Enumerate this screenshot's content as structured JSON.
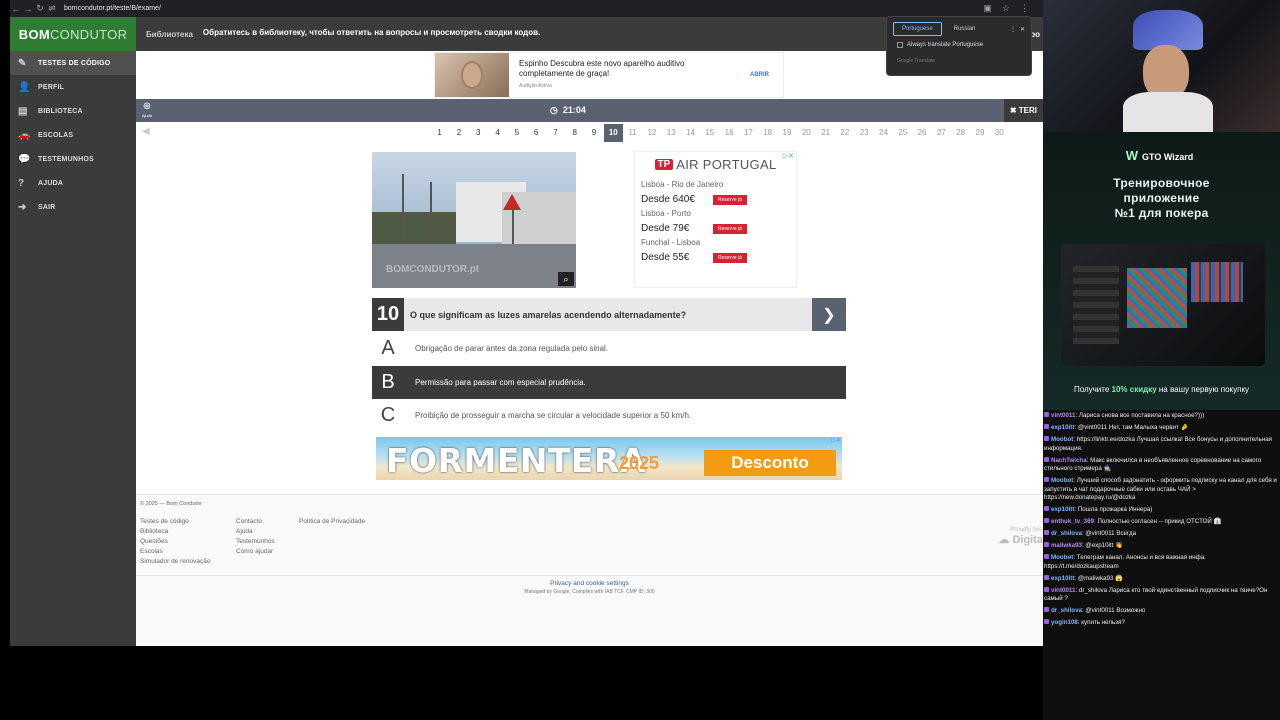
{
  "browser": {
    "url": "bomcondutor.pt/teste/B/exame/",
    "nav_icons": [
      "back-icon",
      "forward-icon",
      "reload-icon",
      "site-info-icon"
    ]
  },
  "logo": {
    "part1": "B",
    "part2": "OM",
    "part3": "CONDUTOR"
  },
  "sidebar": {
    "items": [
      {
        "label": "TESTES DE CÓDIGO",
        "icon": "pencil-icon",
        "glyph": "✎"
      },
      {
        "label": "PERFIL",
        "icon": "user-icon",
        "glyph": "👤"
      },
      {
        "label": "BIBLIOTECA",
        "icon": "book-icon",
        "glyph": "▤"
      },
      {
        "label": "ESCOLAS",
        "icon": "car-icon",
        "glyph": "🚗"
      },
      {
        "label": "TESTEMUNHOS",
        "icon": "comments-icon",
        "glyph": "💬"
      },
      {
        "label": "AJUDA",
        "icon": "question-icon",
        "glyph": "?"
      },
      {
        "label": "SAIR",
        "icon": "exit-icon",
        "glyph": "➜"
      }
    ]
  },
  "topbar": {
    "library": "Библиотека",
    "message": "Обратитесь в библиотеку, чтобы ответить на вопросы и просмотреть сводки кодов.",
    "cut": "аро"
  },
  "translate": {
    "lang1": "Portuguese",
    "lang2": "Russian",
    "always": "Always translate Portuguese",
    "brand": "Google Translate"
  },
  "ad_top": {
    "text": "Espinho Descubra este novo aparelho auditivo completamente de graça!",
    "source": "Audição Activa",
    "button": "ABRIR"
  },
  "timer": {
    "help": "Ajuda",
    "time": "21:04",
    "end": "TERI"
  },
  "questions_nav": {
    "numbers": [
      "1",
      "2",
      "3",
      "4",
      "5",
      "6",
      "7",
      "8",
      "9",
      "10",
      "11",
      "12",
      "13",
      "14",
      "15",
      "16",
      "17",
      "18",
      "19",
      "20",
      "21",
      "22",
      "23",
      "24",
      "25",
      "26",
      "27",
      "28",
      "29",
      "30"
    ],
    "current": "10"
  },
  "question_image": {
    "watermark": "BOMCONDUTOR.pt"
  },
  "ad_right": {
    "tp": "TP",
    "brand_air": "AIR",
    "brand_country": "PORTUGAL",
    "routes": [
      {
        "route": "Lisboa - Rio de Janeiro",
        "price": "Desde 640€",
        "button": "Reserve já"
      },
      {
        "route": "Lisboa - Porto",
        "price": "Desde 79€",
        "button": "Reserve já"
      },
      {
        "route": "Funchal - Lisboa",
        "price": "Desde 55€",
        "button": "Reserve já"
      }
    ]
  },
  "question": {
    "number": "10",
    "text": "O que significam as luzes amarelas acendendo alternadamente?",
    "answers": [
      {
        "letter": "A",
        "text": "Obrigação de parar antes da zona regulada pelo sinal."
      },
      {
        "letter": "B",
        "text": "Permissão para passar com especial prudência."
      },
      {
        "letter": "C",
        "text": "Proibição de prosseguir a marcha se circular a velocidade superior a 50 km/h."
      }
    ],
    "selected": "B"
  },
  "banner": {
    "title": "FORMENTERA",
    "year": "2025",
    "cta": "Desconto"
  },
  "footer": {
    "copyright": "© 2025 — Bom Condutor",
    "col1": [
      "Testes de código",
      "Biblioteca",
      "Questões",
      "Escolas",
      "Simulador de renovação"
    ],
    "col2": [
      "Contacto",
      "Ajuda",
      "Testemunhos",
      "Como ajudar"
    ],
    "col3": [
      "Política de Privacidade"
    ],
    "proudly": "Proudly hos",
    "digita": "Digita",
    "privacy": "Privacy and cookie settings",
    "managed": "Managed by Google. Complies with IAB TCF. CMP ID: 300"
  },
  "stream": {
    "promo_brand": "GTO Wizard",
    "promo_headline_1": "Тренировочное",
    "promo_headline_2": "приложение",
    "promo_headline_3": "№1 для покера",
    "offer_pre": "Получите ",
    "offer_bold": "10% скидку",
    "offer_post": " на вашу первую покупку",
    "chat": [
      {
        "user": "vint0011",
        "color": "#b48cf2",
        "text": "Лариса снова все поставила на красное?)))"
      },
      {
        "user": "exp10itt",
        "color": "#7fb6ff",
        "text": "@vint0011 Нет, там Малыха червит 🤌"
      },
      {
        "user": "Moobot",
        "color": "#7fb6ff",
        "text": "https://linktr.ee/dozka Лучшая ссылка! Все бонусы и дополнительная информация."
      },
      {
        "user": "NachTwicha",
        "color": "#b48cf2",
        "text": "Макс включился в необъявленное соревнование на самого стильного стримера 🧙"
      },
      {
        "user": "Moobot",
        "color": "#7fb6ff",
        "text": "Лучший способ задонатить - оформить подписку на канал для себя и запустить в чат подарочные сабки или оставь ЧАЙ > https://new.donatepay.ru/@dozka"
      },
      {
        "user": "exp10itt",
        "color": "#7fb6ff",
        "text": "Пошла прожарка Иннера)"
      },
      {
        "user": "enthuk_tv_369",
        "color": "#b48cf2",
        "text": "Полностью согласен -- прикид ОТСТОЙ 👔"
      },
      {
        "user": "dr_shilova",
        "color": "#7fb6ff",
        "text": "@vint0011 Всегда"
      },
      {
        "user": "maliwka93",
        "color": "#b48cf2",
        "text": "@exp10itt 👋"
      },
      {
        "user": "Moobot",
        "color": "#7fb6ff",
        "text": "Телеграм канал. Анонсы и вся важная инфа. https://t.me/dozkaupstream"
      },
      {
        "user": "exp10itt",
        "color": "#7fb6ff",
        "text": "@maliwka93 😱"
      },
      {
        "user": "vint0011",
        "color": "#b48cf2",
        "text": "dr_shilova Лариса кто твой единственный подписчик на твиче?Он самый ?"
      },
      {
        "user": "dr_shilova",
        "color": "#7fb6ff",
        "text": "@vint0011 Возможно"
      },
      {
        "user": "yogin108",
        "color": "#7fb6ff",
        "text": "купить нельзя?"
      }
    ]
  }
}
